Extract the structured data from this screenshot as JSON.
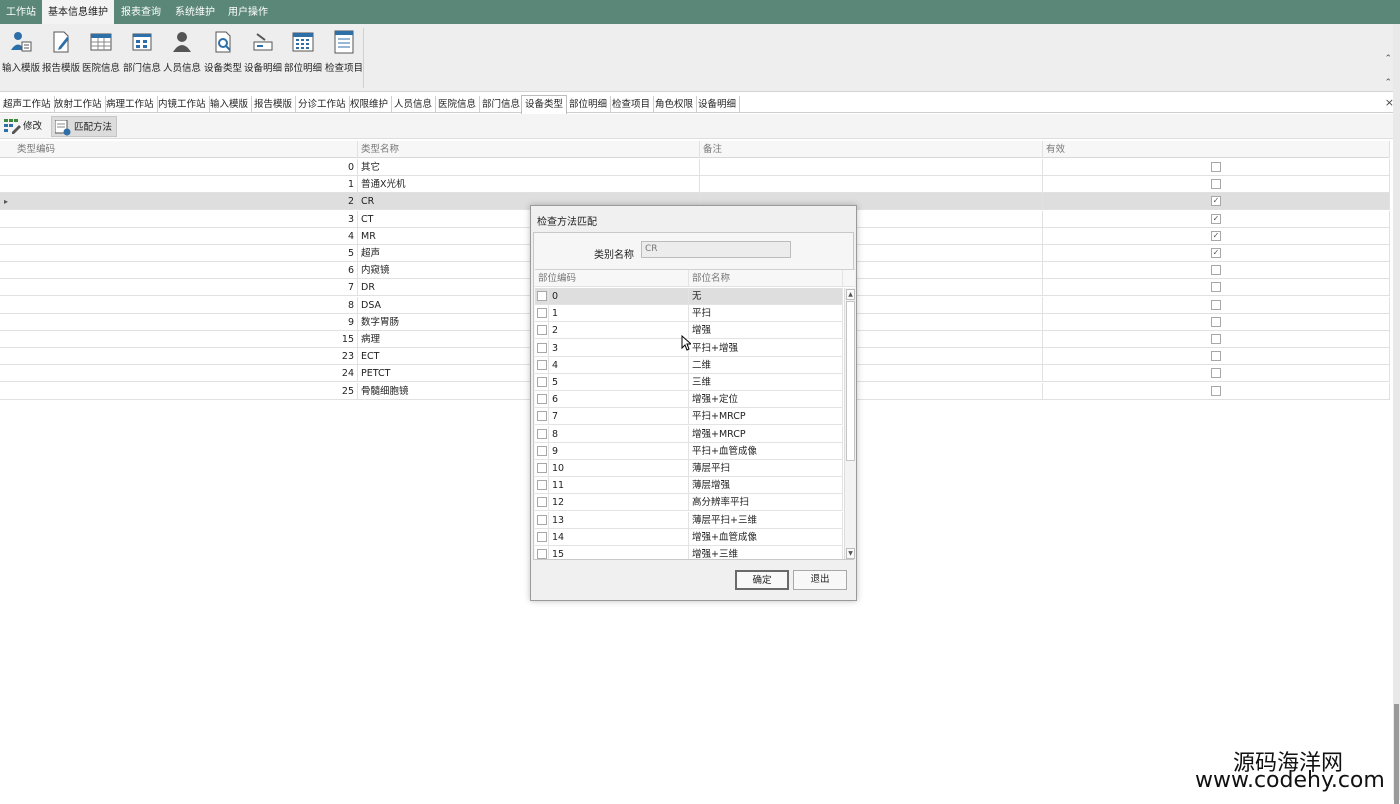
{
  "menu": {
    "items": [
      {
        "label": "工作站",
        "active": false
      },
      {
        "label": "基本信息维护",
        "active": true
      },
      {
        "label": "报表查询",
        "active": false
      },
      {
        "label": "系统维护",
        "active": false
      },
      {
        "label": "用户操作",
        "active": false
      }
    ]
  },
  "ribbon": {
    "buttons": [
      {
        "label": "输入模版",
        "icon": "input-template-icon"
      },
      {
        "label": "报告模版",
        "icon": "report-template-icon"
      },
      {
        "label": "医院信息",
        "icon": "hospital-info-icon"
      },
      {
        "label": "部门信息",
        "icon": "department-info-icon"
      },
      {
        "label": "人员信息",
        "icon": "person-info-icon"
      },
      {
        "label": "设备类型",
        "icon": "device-type-icon"
      },
      {
        "label": "设备明细",
        "icon": "device-detail-icon"
      },
      {
        "label": "部位明细",
        "icon": "body-part-detail-icon"
      },
      {
        "label": "检查项目",
        "icon": "exam-item-icon"
      }
    ],
    "collapse_symbol": "⌃"
  },
  "tabs": {
    "items": [
      {
        "label": "超声工作站"
      },
      {
        "label": "放射工作站"
      },
      {
        "label": "病理工作站"
      },
      {
        "label": "内镜工作站"
      },
      {
        "label": "输入模版"
      },
      {
        "label": "报告模版"
      },
      {
        "label": "分诊工作站"
      },
      {
        "label": "权限维护"
      },
      {
        "label": "人员信息"
      },
      {
        "label": "医院信息"
      },
      {
        "label": "部门信息"
      },
      {
        "label": "设备类型",
        "active": true
      },
      {
        "label": "部位明细"
      },
      {
        "label": "检查项目"
      },
      {
        "label": "角色权限"
      },
      {
        "label": "设备明细"
      }
    ],
    "close_symbol": "×"
  },
  "toolbar": {
    "edit_label": "修改",
    "match_label": "匹配方法"
  },
  "grid": {
    "columns": [
      "类型编码",
      "类型名称",
      "备注",
      "有效"
    ],
    "rows": [
      {
        "code": "0",
        "name": "其它",
        "note": "",
        "valid": false
      },
      {
        "code": "1",
        "name": "普通X光机",
        "note": "",
        "valid": false
      },
      {
        "code": "2",
        "name": "CR",
        "note": "",
        "valid": true,
        "selected": true
      },
      {
        "code": "3",
        "name": "CT",
        "note": "",
        "valid": true
      },
      {
        "code": "4",
        "name": "MR",
        "note": "",
        "valid": true
      },
      {
        "code": "5",
        "name": "超声",
        "note": "",
        "valid": true
      },
      {
        "code": "6",
        "name": "内窥镜",
        "note": "",
        "valid": false
      },
      {
        "code": "7",
        "name": "DR",
        "note": "",
        "valid": false
      },
      {
        "code": "8",
        "name": "DSA",
        "note": "",
        "valid": false
      },
      {
        "code": "9",
        "name": "数字胃肠",
        "note": "",
        "valid": false
      },
      {
        "code": "15",
        "name": "病理",
        "note": "",
        "valid": false
      },
      {
        "code": "23",
        "name": "ECT",
        "note": "",
        "valid": false
      },
      {
        "code": "24",
        "name": "PETCT",
        "note": "",
        "valid": false
      },
      {
        "code": "25",
        "name": "骨髓细胞镜",
        "note": "",
        "valid": false
      }
    ],
    "row_indicator": "▸"
  },
  "dialog": {
    "title": "检查方法匹配",
    "category_label": "类别名称",
    "category_value": "CR",
    "columns": [
      "部位编码",
      "部位名称"
    ],
    "rows": [
      {
        "code": "0",
        "name": "无",
        "selected": true
      },
      {
        "code": "1",
        "name": "平扫"
      },
      {
        "code": "2",
        "name": "增强"
      },
      {
        "code": "3",
        "name": "平扫+增强"
      },
      {
        "code": "4",
        "name": "二维"
      },
      {
        "code": "5",
        "name": "三维"
      },
      {
        "code": "6",
        "name": "增强+定位"
      },
      {
        "code": "7",
        "name": "平扫+MRCP"
      },
      {
        "code": "8",
        "name": "增强+MRCP"
      },
      {
        "code": "9",
        "name": "平扫+血管成像"
      },
      {
        "code": "10",
        "name": "薄层平扫"
      },
      {
        "code": "11",
        "name": "薄层增强"
      },
      {
        "code": "12",
        "name": "高分辨率平扫"
      },
      {
        "code": "13",
        "name": "薄层平扫+三维"
      },
      {
        "code": "14",
        "name": "增强+血管成像"
      },
      {
        "code": "15",
        "name": "增强+三维"
      }
    ],
    "scroll_up": "▲",
    "scroll_down": "▼",
    "ok_label": "确定",
    "exit_label": "退出"
  },
  "watermark": {
    "line1": "源码海洋网",
    "line2": "www.codehy.com"
  },
  "colors": {
    "menubar": "#5a8778",
    "selected_row": "#dedede"
  }
}
